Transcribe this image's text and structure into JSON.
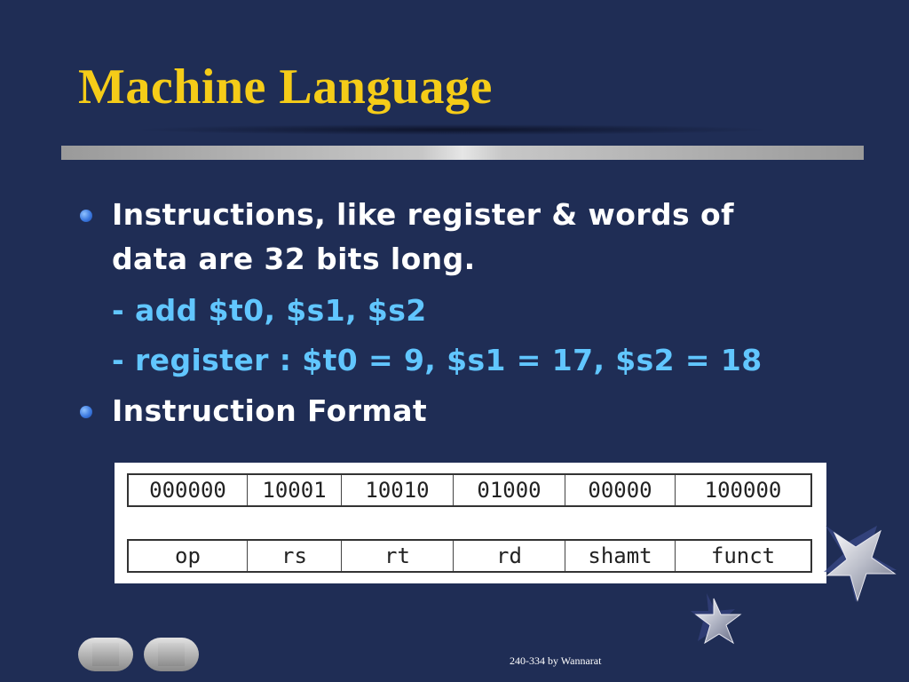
{
  "slide": {
    "title": "Machine Language",
    "bullets": [
      {
        "line1": "Instructions, like register & words of",
        "line2": "data are 32 bits long."
      },
      {
        "line1": "Instruction Format"
      }
    ],
    "subitems": [
      "- add $t0, $s1, $s2",
      "- register : $t0 = 9, $s1 = 17, $s2 = 18"
    ],
    "format": {
      "bits": [
        "000000",
        "10001",
        "10010",
        "01000",
        "00000",
        "100000"
      ],
      "fields": [
        "op",
        "rs",
        "rt",
        "rd",
        "shamt",
        "funct"
      ]
    },
    "footer": "240-334 by Wannarat"
  },
  "colors": {
    "background": "#1f2d55",
    "title": "#f5cc18",
    "body_text": "#ffffff",
    "sub_text": "#61c6ff",
    "bullet": "#3d7ae0"
  },
  "icons": [
    "previous-slide-icon",
    "next-slide-icon",
    "star-decoration-icon"
  ]
}
